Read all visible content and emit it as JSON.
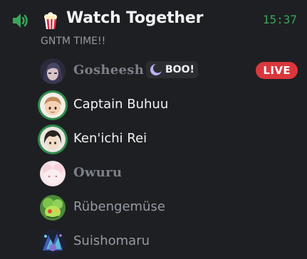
{
  "channel": {
    "title": "Watch Together",
    "time": "15:37",
    "status": "GNTM TIME!!",
    "icons": {
      "voice": "speaker-icon",
      "emoji": "popcorn-icon"
    }
  },
  "members": [
    {
      "name": "Gosheesh",
      "tag": "BOO!",
      "badge": "LIVE",
      "speaking": false
    },
    {
      "name": "Captain Buhuu",
      "speaking": true
    },
    {
      "name": "Ken'ichi Rei",
      "speaking": true
    },
    {
      "name": "Owuru",
      "speaking": false
    },
    {
      "name": "Rübengemüse",
      "speaking": false
    },
    {
      "name": "Suishomaru",
      "speaking": false
    }
  ],
  "colors": {
    "background": "#1e1f22",
    "speaking_ring": "#2f8d4c",
    "live_badge": "#da373c",
    "time": "#3ba55d"
  }
}
